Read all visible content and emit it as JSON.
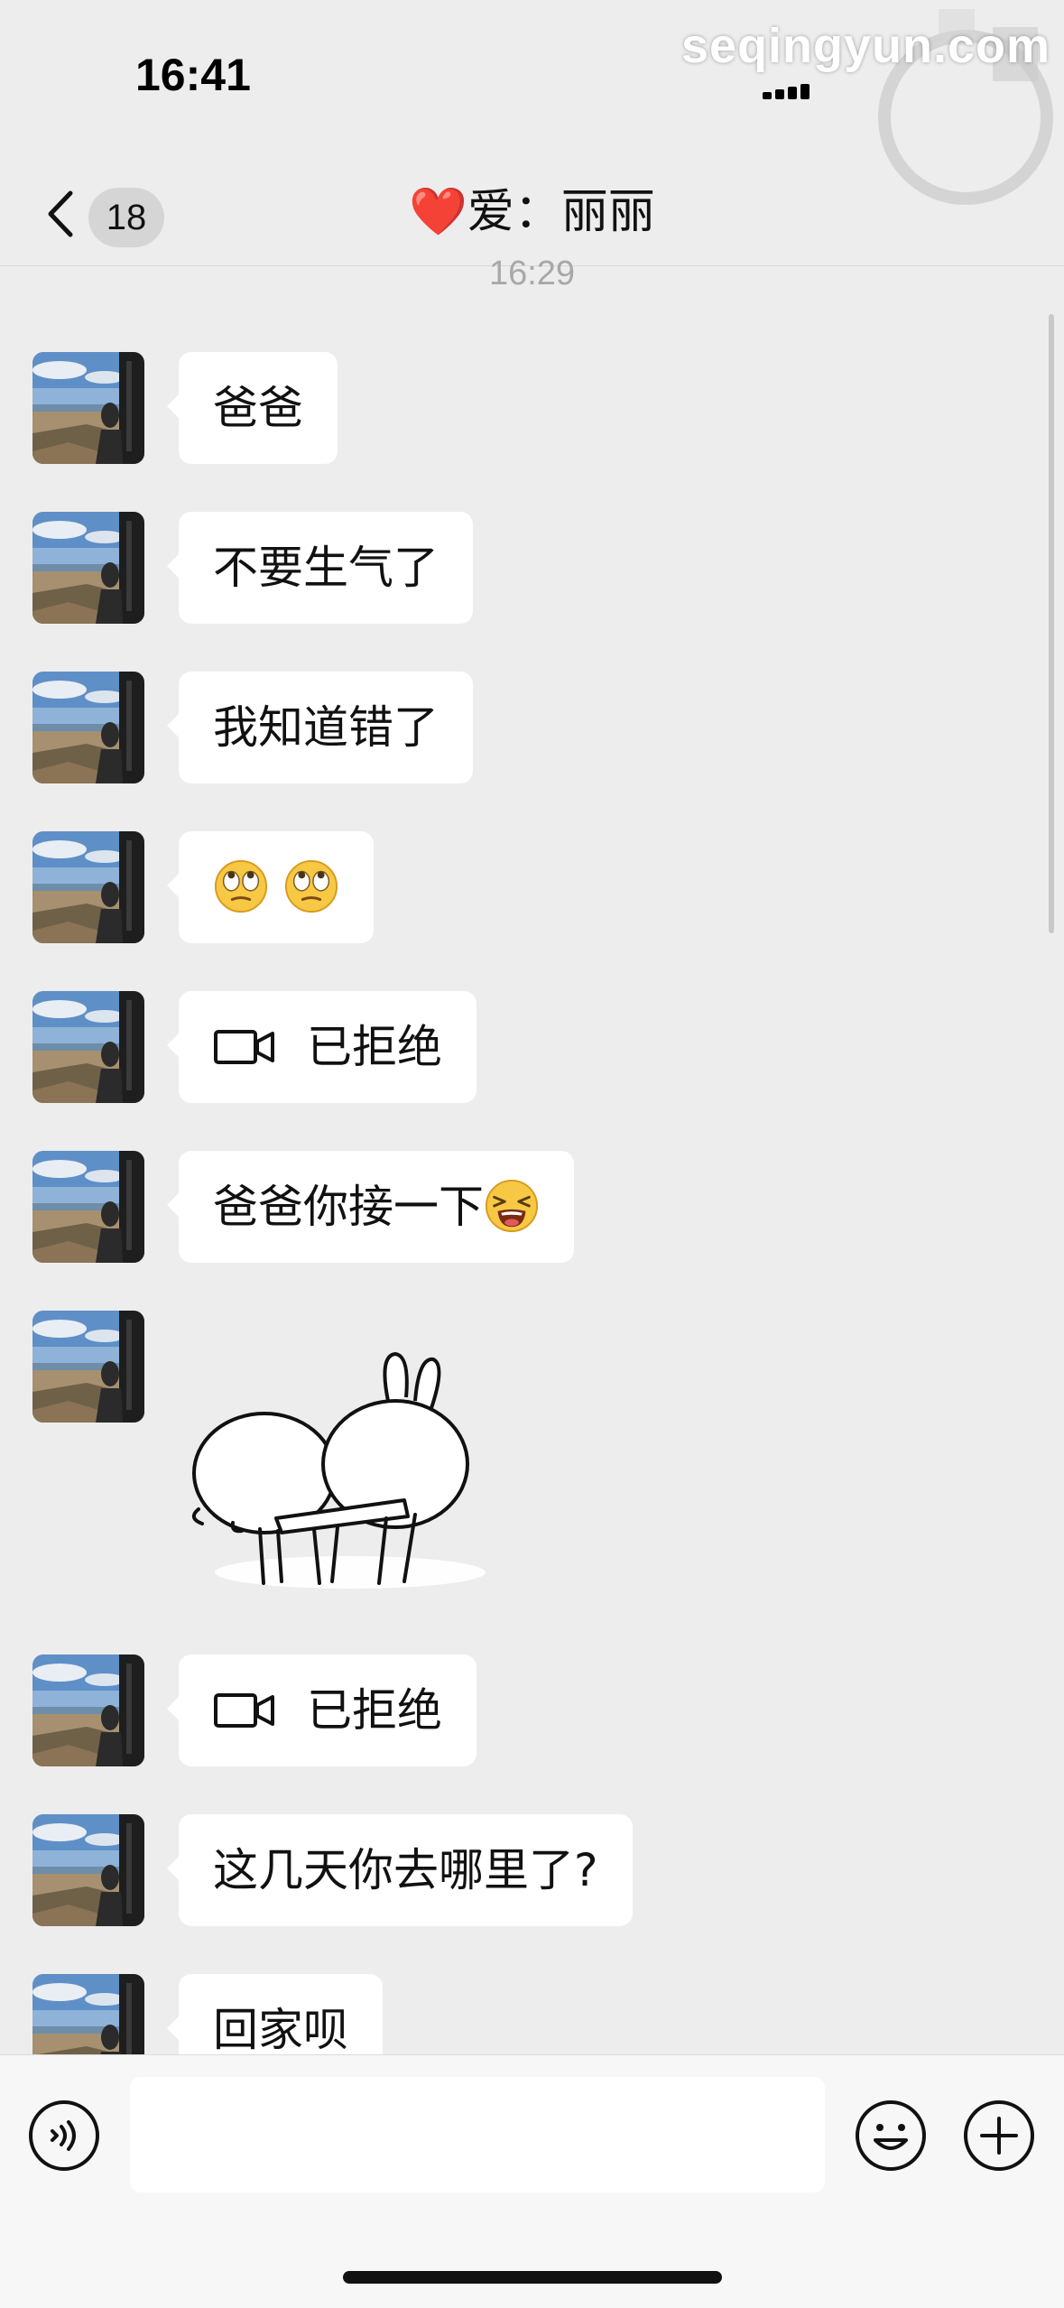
{
  "status_bar": {
    "time": "16:41",
    "watermark": "seqingyun.com"
  },
  "nav": {
    "back_count": "18",
    "title": "❤️爱：丽丽"
  },
  "chat": {
    "timestamp": "16:29",
    "messages": [
      {
        "type": "text",
        "text": "爸爸"
      },
      {
        "type": "text",
        "text": "不要生气了"
      },
      {
        "type": "text",
        "text": "我知道错了"
      },
      {
        "type": "emoji",
        "emojis": [
          "eye-roll-emoji",
          "eye-roll-emoji"
        ]
      },
      {
        "type": "video-call",
        "text": "已拒绝",
        "icon": "video-camera-icon"
      },
      {
        "type": "text",
        "text": "爸爸你接一下",
        "emoji": "tired-face-emoji"
      },
      {
        "type": "sticker",
        "sticker": "bunny-sticker"
      },
      {
        "type": "video-call",
        "text": "已拒绝",
        "icon": "video-camera-icon"
      },
      {
        "type": "text",
        "text": "这几天你去哪里了?"
      },
      {
        "type": "text",
        "text": "回家呗"
      }
    ]
  },
  "input_bar": {
    "voice_icon": "voice-icon",
    "emoji_icon": "emoji-icon",
    "plus_icon": "plus-icon",
    "input_value": ""
  },
  "colors": {
    "background": "#EDEDED",
    "bubble": "#FFFFFF",
    "text": "#111111",
    "timestamp": "#A8A8A8",
    "heart": "#E5202A"
  }
}
